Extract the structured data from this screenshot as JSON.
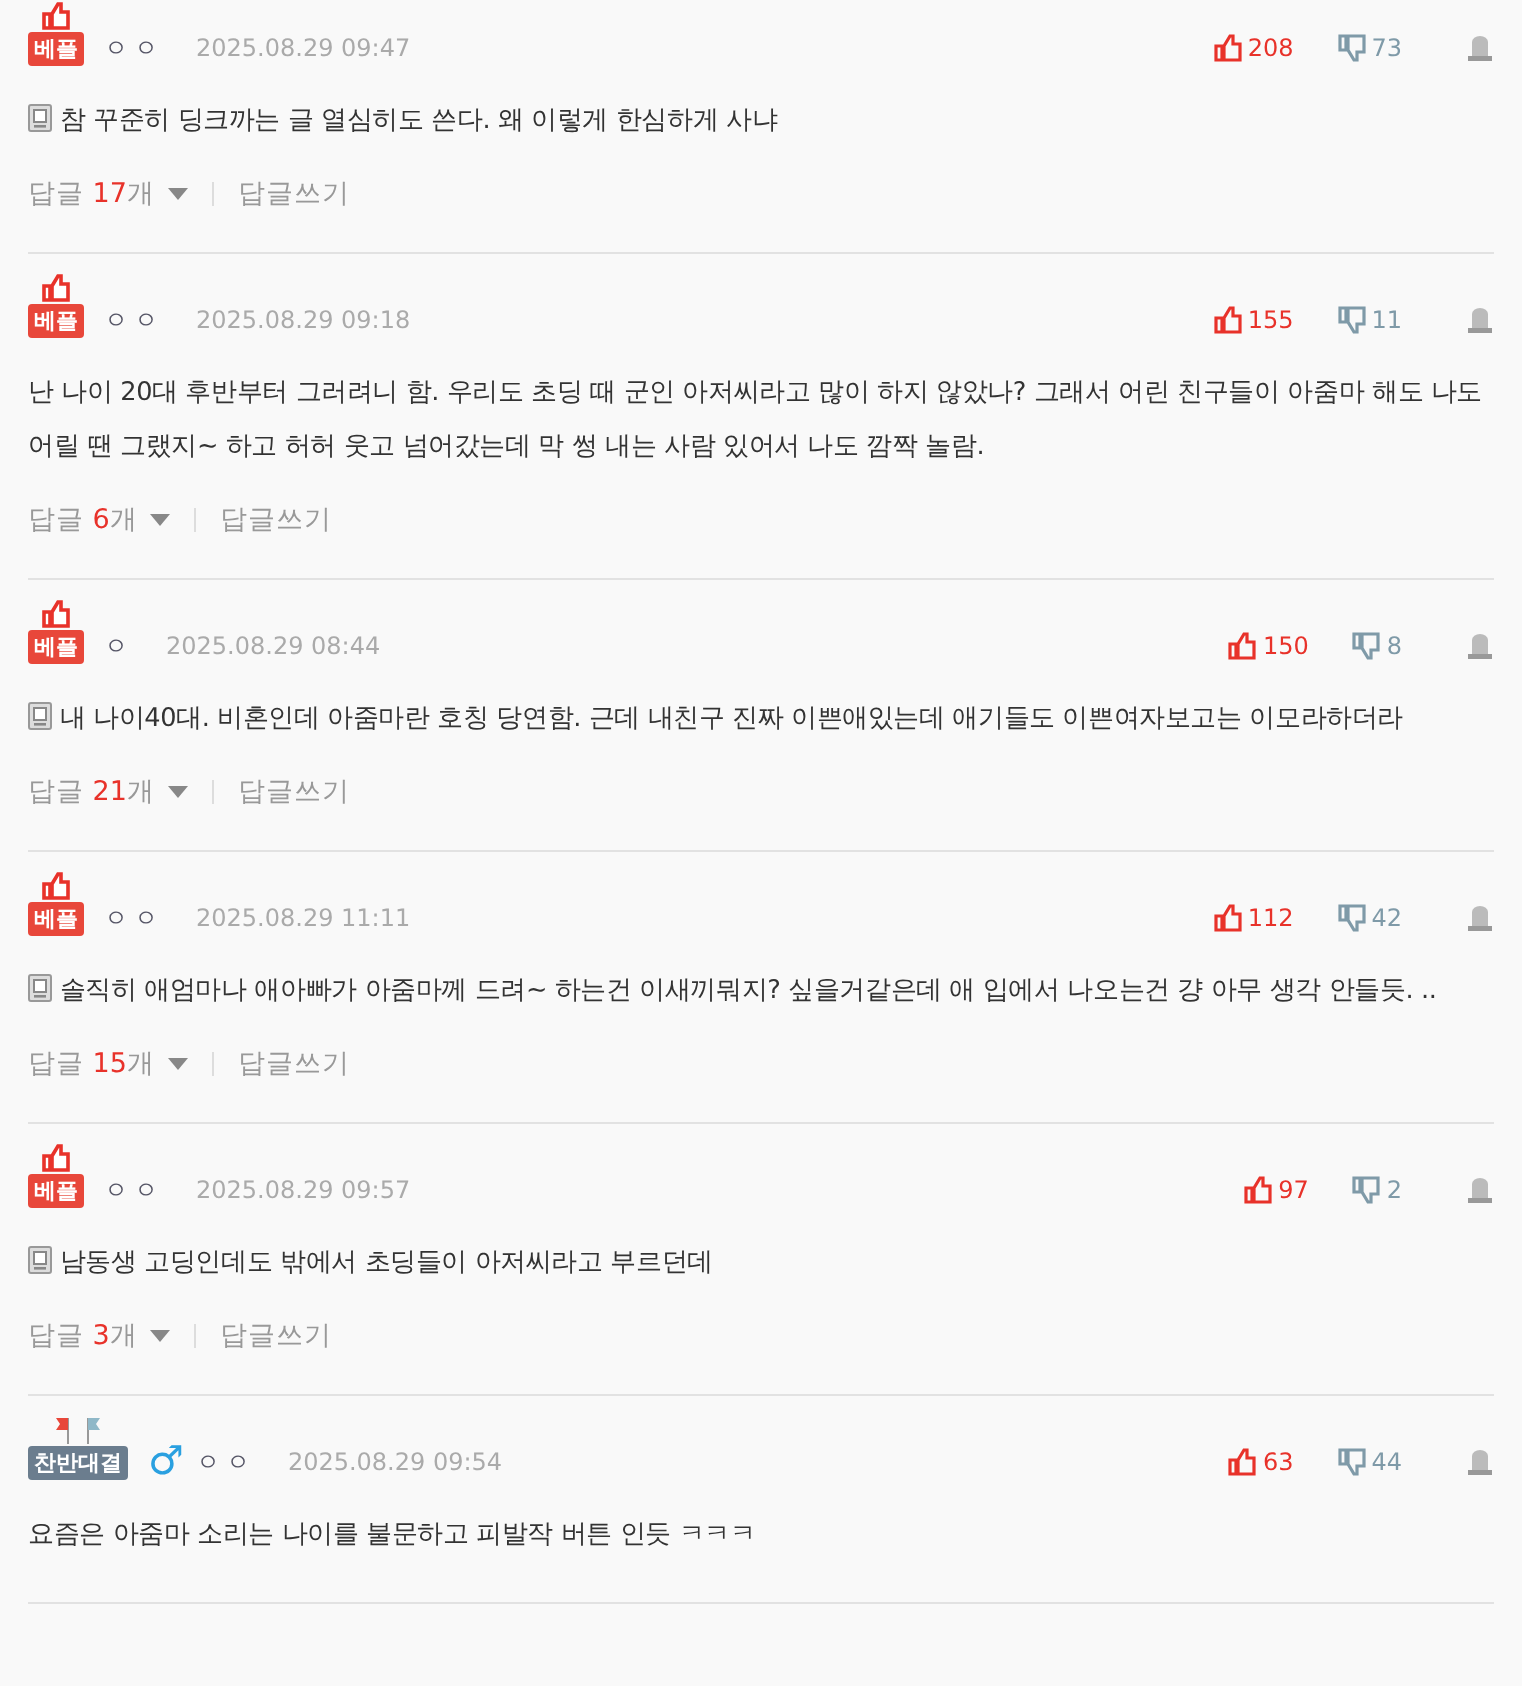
{
  "comments": [
    {
      "badge": {
        "kind": "best",
        "label": "베플"
      },
      "user": "ㅇㅇ",
      "date": "2025.08.29 09:47",
      "up": "208",
      "down": "73",
      "mobile": true,
      "text": "참 꾸준히 딩크까는 글 열심히도 쓴다. 왜 이렇게 한심하게 사냐",
      "replies": {
        "prefix": "답글",
        "count": "17",
        "suffix": "개",
        "write": "답글쓰기"
      }
    },
    {
      "badge": {
        "kind": "best",
        "label": "베플"
      },
      "user": "ㅇㅇ",
      "date": "2025.08.29 09:18",
      "up": "155",
      "down": "11",
      "mobile": false,
      "text": "난 나이 20대 후반부터 그러려니 함. 우리도 초딩 때 군인 아저씨라고 많이 하지 않았나? 그래서 어린 친구들이 아줌마 해도 나도 어릴 땐 그랬지~ 하고 허허 웃고 넘어갔는데 막 썽 내는 사람 있어서 나도 깜짝 놀람.",
      "replies": {
        "prefix": "답글",
        "count": "6",
        "suffix": "개",
        "write": "답글쓰기"
      }
    },
    {
      "badge": {
        "kind": "best",
        "label": "베플"
      },
      "user": "ㅇ",
      "date": "2025.08.29 08:44",
      "up": "150",
      "down": "8",
      "mobile": true,
      "text": "내 나이40대. 비혼인데 아줌마란 호칭 당연함. 근데 내친구 진짜 이쁜애있는데 애기들도 이쁜여자보고는 이모라하더라",
      "replies": {
        "prefix": "답글",
        "count": "21",
        "suffix": "개",
        "write": "답글쓰기"
      }
    },
    {
      "badge": {
        "kind": "best",
        "label": "베플"
      },
      "user": "ㅇㅇ",
      "date": "2025.08.29 11:11",
      "up": "112",
      "down": "42",
      "mobile": true,
      "text": "솔직히 애엄마나 애아빠가 아줌마께 드려~ 하는건 이새끼뭐지? 싶을거같은데 애 입에서 나오는건 걍 아무 생각 안들듯. ..",
      "replies": {
        "prefix": "답글",
        "count": "15",
        "suffix": "개",
        "write": "답글쓰기"
      }
    },
    {
      "badge": {
        "kind": "best",
        "label": "베플"
      },
      "user": "ㅇㅇ",
      "date": "2025.08.29 09:57",
      "up": "97",
      "down": "2",
      "mobile": true,
      "text": "남동생 고딩인데도 밖에서 초딩들이 아저씨라고 부르던데",
      "replies": {
        "prefix": "답글",
        "count": "3",
        "suffix": "개",
        "write": "답글쓰기"
      }
    },
    {
      "badge": {
        "kind": "vs",
        "label": "찬반대결"
      },
      "gender": "♂",
      "user": "ㅇㅇ",
      "date": "2025.08.29 09:54",
      "up": "63",
      "down": "44",
      "mobile": false,
      "text": "요즘은 아줌마 소리는 나이를 불문하고 피발작 버튼 인듯 ㅋㅋㅋ"
    }
  ]
}
